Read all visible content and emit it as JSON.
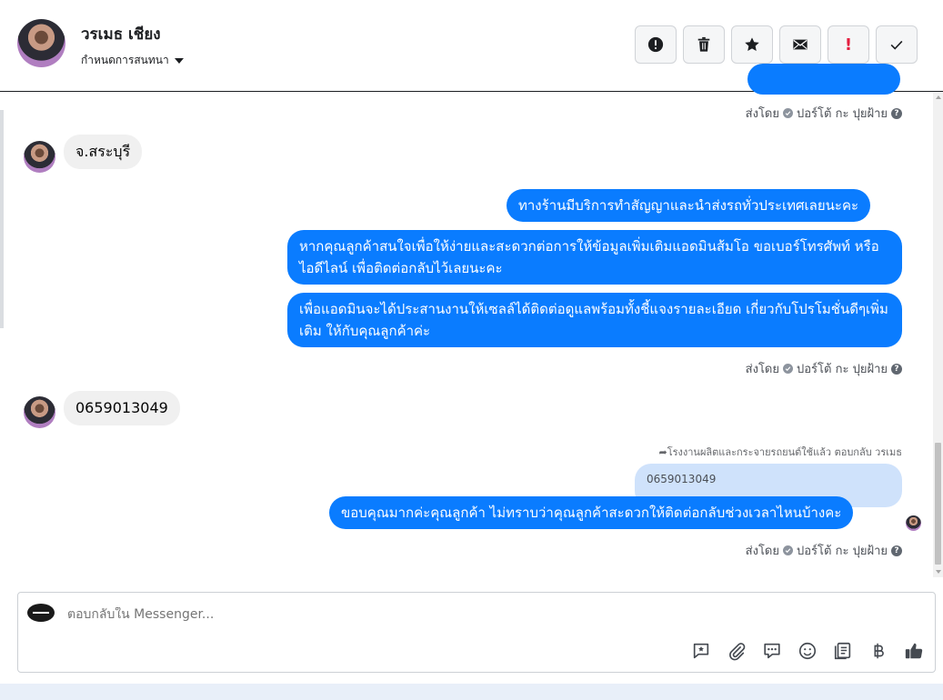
{
  "header": {
    "name": "วรเมธ เชียง",
    "subtitle": "กำหนดการสนทนา"
  },
  "actions": [
    {
      "name": "spam-button",
      "icon": "alert-circle-icon"
    },
    {
      "name": "delete-button",
      "icon": "trash-icon"
    },
    {
      "name": "star-button",
      "icon": "star-icon"
    },
    {
      "name": "mark-unread-button",
      "icon": "envelope-icon"
    },
    {
      "name": "follow-up-button",
      "label": "!"
    },
    {
      "name": "done-button",
      "icon": "check-icon"
    }
  ],
  "messages": {
    "sent_by_label": "ส่งโดย",
    "sender_name": "ปอร์โต้ กะ ปุยฝ้าย",
    "in_1": "จ.สระบุรี",
    "out_1": "ทางร้านมีบริการทำสัญญาและนำส่งรถทั่วประเทศเลยนะคะ",
    "out_2": "หากคุณลูกค้าสนใจเพื่อให้ง่ายและสะดวกต่อการให้ข้อมูลเพิ่มเติมแอดมินส้มโอ ขอเบอร์โทรศัพท์ หรือ ไอดีไลน์ เพื่อติดต่อกลับไว้เลยนะคะ",
    "out_3": "เพื่อแอดมินจะได้ประสานงานให้เซลล์ได้ติดต่อดูแลพร้อมทั้งชี้แจงรายละเอียด เกี่ยวกับโปรโมชั่นดีๆเพิ่มเติม ให้กับคุณลูกค้าค่ะ",
    "in_2": "0659013049",
    "reply_note": "โรงงานผลิตและกระจายรถยนต์ใช้แล้ว ตอบกลับ วรเมธ",
    "quoted": "0659013049",
    "out_4": "ขอบคุณมากค่ะคุณลูกค้า ไม่ทราบว่าคุณลูกค้าสะดวกให้ติดต่อกลับช่วงเวลาไหนบ้างคะ"
  },
  "composer": {
    "placeholder": "ตอบกลับใน Messenger..."
  },
  "tools": [
    "saved-reply-icon",
    "attachment-icon",
    "chat-bubble-icon",
    "emoji-icon",
    "catalog-icon",
    "baht-icon",
    "thumbs-up-icon"
  ],
  "colors": {
    "accent": "#0a7cff",
    "incoming": "#f0f0f0",
    "quoted": "#cfe2fb",
    "follow_up": "#e41e3f"
  }
}
